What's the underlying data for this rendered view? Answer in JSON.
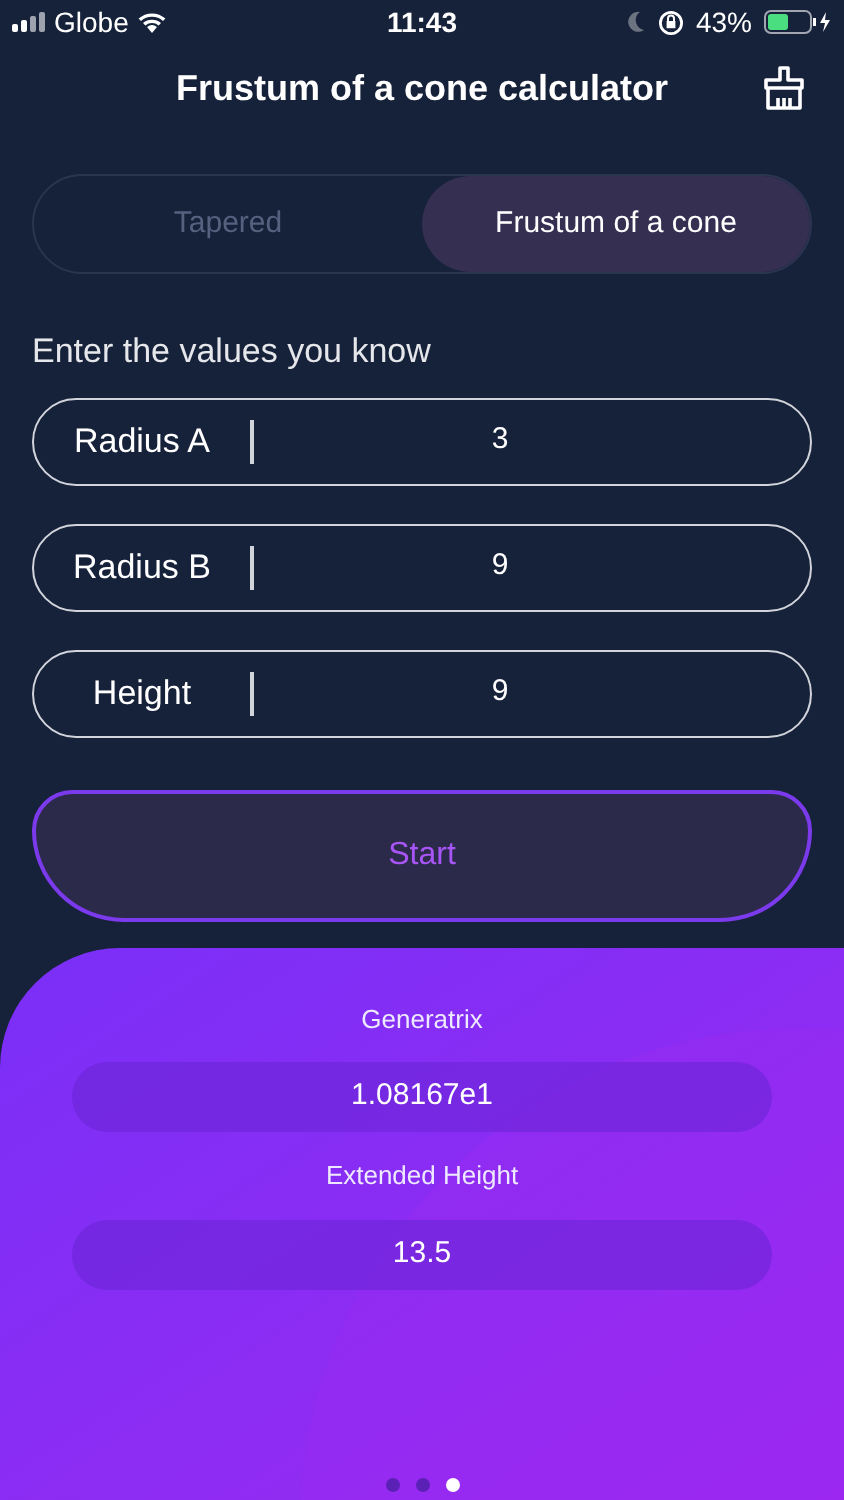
{
  "status_bar": {
    "carrier": "Globe",
    "time": "11:43",
    "battery": "43%"
  },
  "title": "Frustum of a cone calculator",
  "tabs": [
    {
      "label": "Tapered",
      "selected": false
    },
    {
      "label": "Frustum of a cone",
      "selected": true
    }
  ],
  "prompt": "Enter the values you know",
  "fields": [
    {
      "label": "Radius A",
      "value": "3"
    },
    {
      "label": "Radius B",
      "value": "9"
    },
    {
      "label": "Height",
      "value": "9"
    }
  ],
  "start_button": "Start",
  "results": [
    {
      "label": "Generatrix",
      "value": "1.08167e1"
    },
    {
      "label": "Extended Height",
      "value": "13.5"
    }
  ],
  "pages": [
    {
      "selected": false
    },
    {
      "selected": false
    },
    {
      "selected": true
    }
  ]
}
